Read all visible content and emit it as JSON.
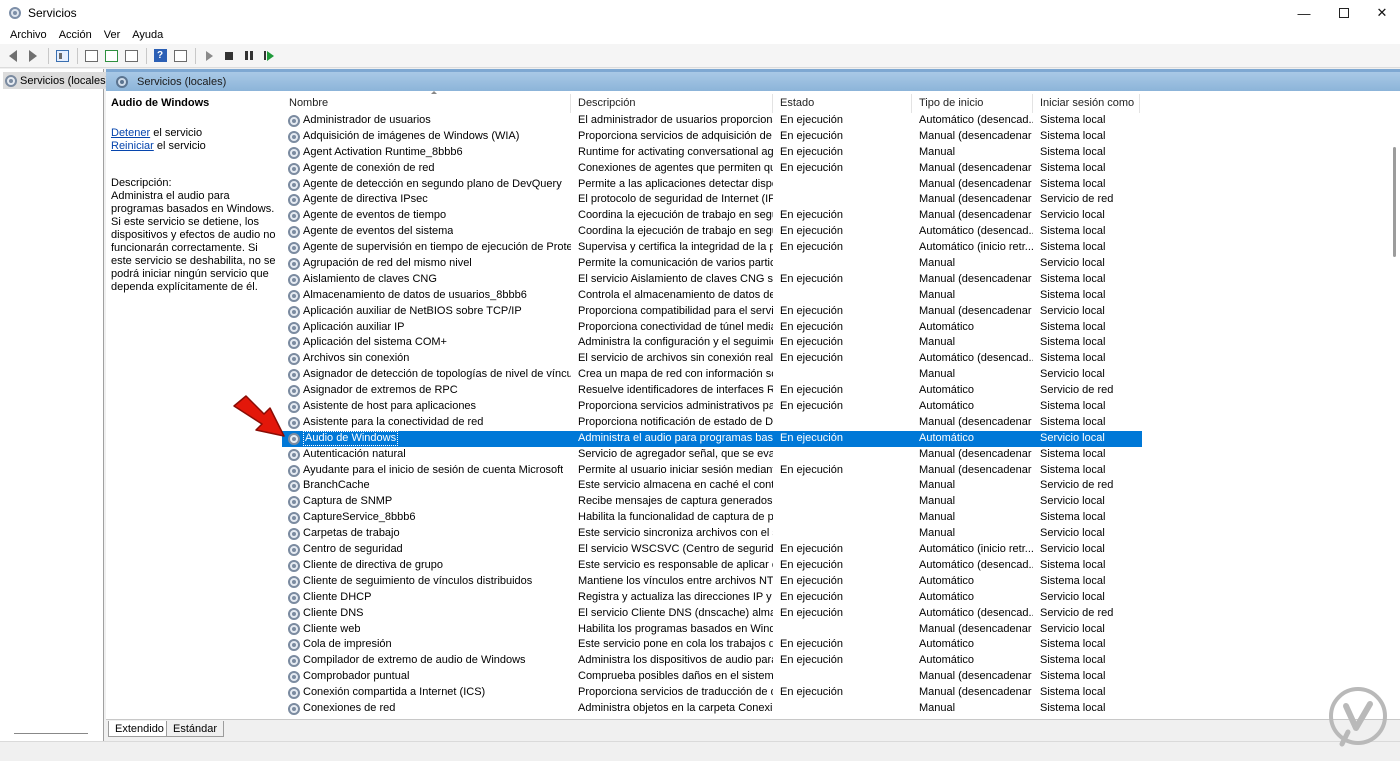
{
  "window": {
    "title": "Servicios"
  },
  "menu": [
    "Archivo",
    "Acción",
    "Ver",
    "Ayuda"
  ],
  "tree": {
    "root_label": "Servicios (locales)"
  },
  "panel": {
    "header": "Servicios (locales)",
    "selected_service": "Audio de Windows",
    "stop_link": "Detener",
    "stop_suffix": " el servicio",
    "restart_link": "Reiniciar",
    "restart_suffix": " el servicio",
    "description_label": "Descripción:",
    "description": "Administra el audio para programas basados en Windows. Si este servicio se detiene, los dispositivos y efectos de audio no funcionarán correctamente. Si este servicio se deshabilita, no se podrá iniciar ningún servicio que dependa explícitamente de él."
  },
  "columns": [
    "Nombre",
    "Descripción",
    "Estado",
    "Tipo de inicio",
    "Iniciar sesión como"
  ],
  "rows": [
    [
      "Administrador de usuarios",
      "El administrador de usuarios proporciona...",
      "En ejecución",
      "Automático (desencad...",
      "Sistema local"
    ],
    [
      "Adquisición de imágenes de Windows (WIA)",
      "Proporciona servicios de adquisición de i...",
      "En ejecución",
      "Manual (desencadenar ...",
      "Sistema local"
    ],
    [
      "Agent Activation Runtime_8bbb6",
      "Runtime for activating conversational ag...",
      "En ejecución",
      "Manual",
      "Sistema local"
    ],
    [
      "Agente de conexión de red",
      "Conexiones de agentes que permiten que...",
      "En ejecución",
      "Manual (desencadenar ...",
      "Sistema local"
    ],
    [
      "Agente de detección en segundo plano de DevQuery",
      "Permite a las aplicaciones detectar dispos...",
      "",
      "Manual (desencadenar ...",
      "Sistema local"
    ],
    [
      "Agente de directiva IPsec",
      "El protocolo de seguridad de Internet (IPS...",
      "",
      "Manual (desencadenar ...",
      "Servicio de red"
    ],
    [
      "Agente de eventos de tiempo",
      "Coordina la ejecución de trabajo en segu...",
      "En ejecución",
      "Manual (desencadenar ...",
      "Servicio local"
    ],
    [
      "Agente de eventos del sistema",
      "Coordina la ejecución de trabajo en segu...",
      "En ejecución",
      "Automático (desencad...",
      "Sistema local"
    ],
    [
      "Agente de supervisión en tiempo de ejecución de Protecci...",
      "Supervisa y certifica la integridad de la pl...",
      "En ejecución",
      "Automático (inicio retr...",
      "Sistema local"
    ],
    [
      "Agrupación de red del mismo nivel",
      "Permite la comunicación de varios partici...",
      "",
      "Manual",
      "Servicio local"
    ],
    [
      "Aislamiento de claves CNG",
      "El servicio Aislamiento de claves CNG se ...",
      "En ejecución",
      "Manual (desencadenar ...",
      "Sistema local"
    ],
    [
      "Almacenamiento de datos de usuarios_8bbb6",
      "Controla el almacenamiento de datos de ...",
      "",
      "Manual",
      "Sistema local"
    ],
    [
      "Aplicación auxiliar de NetBIOS sobre TCP/IP",
      "Proporciona compatibilidad para el servic...",
      "En ejecución",
      "Manual (desencadenar ...",
      "Servicio local"
    ],
    [
      "Aplicación auxiliar IP",
      "Proporciona conectividad de túnel media...",
      "En ejecución",
      "Automático",
      "Sistema local"
    ],
    [
      "Aplicación del sistema COM+",
      "Administra la configuración y el seguimie...",
      "En ejecución",
      "Manual",
      "Sistema local"
    ],
    [
      "Archivos sin conexión",
      "El servicio de archivos sin conexión realiz...",
      "En ejecución",
      "Automático (desencad...",
      "Sistema local"
    ],
    [
      "Asignador de detección de topologías de nivel de vínculo",
      "Crea un mapa de red con información so...",
      "",
      "Manual",
      "Servicio local"
    ],
    [
      "Asignador de extremos de RPC",
      "Resuelve identificadores de interfaces RP...",
      "En ejecución",
      "Automático",
      "Servicio de red"
    ],
    [
      "Asistente de host para aplicaciones",
      "Proporciona servicios administrativos par...",
      "En ejecución",
      "Automático",
      "Sistema local"
    ],
    [
      "Asistente para la conectividad de red",
      "Proporciona notificación de estado de Dir...",
      "",
      "Manual (desencadenar ...",
      "Sistema local"
    ],
    [
      "Audio de Windows",
      "Administra el audio para programas basa...",
      "En ejecución",
      "Automático",
      "Servicio local"
    ],
    [
      "Autenticación natural",
      "Servicio de agregador señal, que se evalú...",
      "",
      "Manual (desencadenar ...",
      "Sistema local"
    ],
    [
      "Ayudante para el inicio de sesión de cuenta Microsoft",
      "Permite al usuario iniciar sesión mediante...",
      "En ejecución",
      "Manual (desencadenar ...",
      "Sistema local"
    ],
    [
      "BranchCache",
      "Este servicio almacena en caché el conte...",
      "",
      "Manual",
      "Servicio de red"
    ],
    [
      "Captura de SNMP",
      "Recibe mensajes de captura generados p...",
      "",
      "Manual",
      "Servicio local"
    ],
    [
      "CaptureService_8bbb6",
      "Habilita la funcionalidad de captura de p...",
      "",
      "Manual",
      "Sistema local"
    ],
    [
      "Carpetas de trabajo",
      "Este servicio sincroniza archivos con el s...",
      "",
      "Manual",
      "Servicio local"
    ],
    [
      "Centro de seguridad",
      "El servicio WSCSVC (Centro de seguridad ...",
      "En ejecución",
      "Automático (inicio retr...",
      "Servicio local"
    ],
    [
      "Cliente de directiva de grupo",
      "Este servicio es responsable de aplicar en ...",
      "En ejecución",
      "Automático (desencad...",
      "Sistema local"
    ],
    [
      "Cliente de seguimiento de vínculos distribuidos",
      "Mantiene los vínculos entre archivos NTF...",
      "En ejecución",
      "Automático",
      "Sistema local"
    ],
    [
      "Cliente DHCP",
      "Registra y actualiza las direcciones IP y lo...",
      "En ejecución",
      "Automático",
      "Servicio local"
    ],
    [
      "Cliente DNS",
      "El servicio Cliente DNS (dnscache) almac...",
      "En ejecución",
      "Automático (desencad...",
      "Servicio de red"
    ],
    [
      "Cliente web",
      "Habilita los programas basados en Windo...",
      "",
      "Manual (desencadenar ...",
      "Servicio local"
    ],
    [
      "Cola de impresión",
      "Este servicio pone en cola los trabajos de ...",
      "En ejecución",
      "Automático",
      "Sistema local"
    ],
    [
      "Compilador de extremo de audio de Windows",
      "Administra los dispositivos de audio para ...",
      "En ejecución",
      "Automático",
      "Sistema local"
    ],
    [
      "Comprobador puntual",
      "Comprueba posibles daños en el sistema ...",
      "",
      "Manual (desencadenar ...",
      "Sistema local"
    ],
    [
      "Conexión compartida a Internet (ICS)",
      "Proporciona servicios de traducción de di...",
      "En ejecución",
      "Manual (desencadenar ...",
      "Sistema local"
    ],
    [
      "Conexiones de red",
      "Administra objetos en la carpeta Conexio...",
      "",
      "Manual",
      "Sistema local"
    ]
  ],
  "selected_index": 20,
  "tabs": [
    "Extendido",
    "Estándar"
  ],
  "colors": {
    "selection": "#0078d7",
    "header": "#a9c9e6",
    "annotation": "#e3170a"
  }
}
